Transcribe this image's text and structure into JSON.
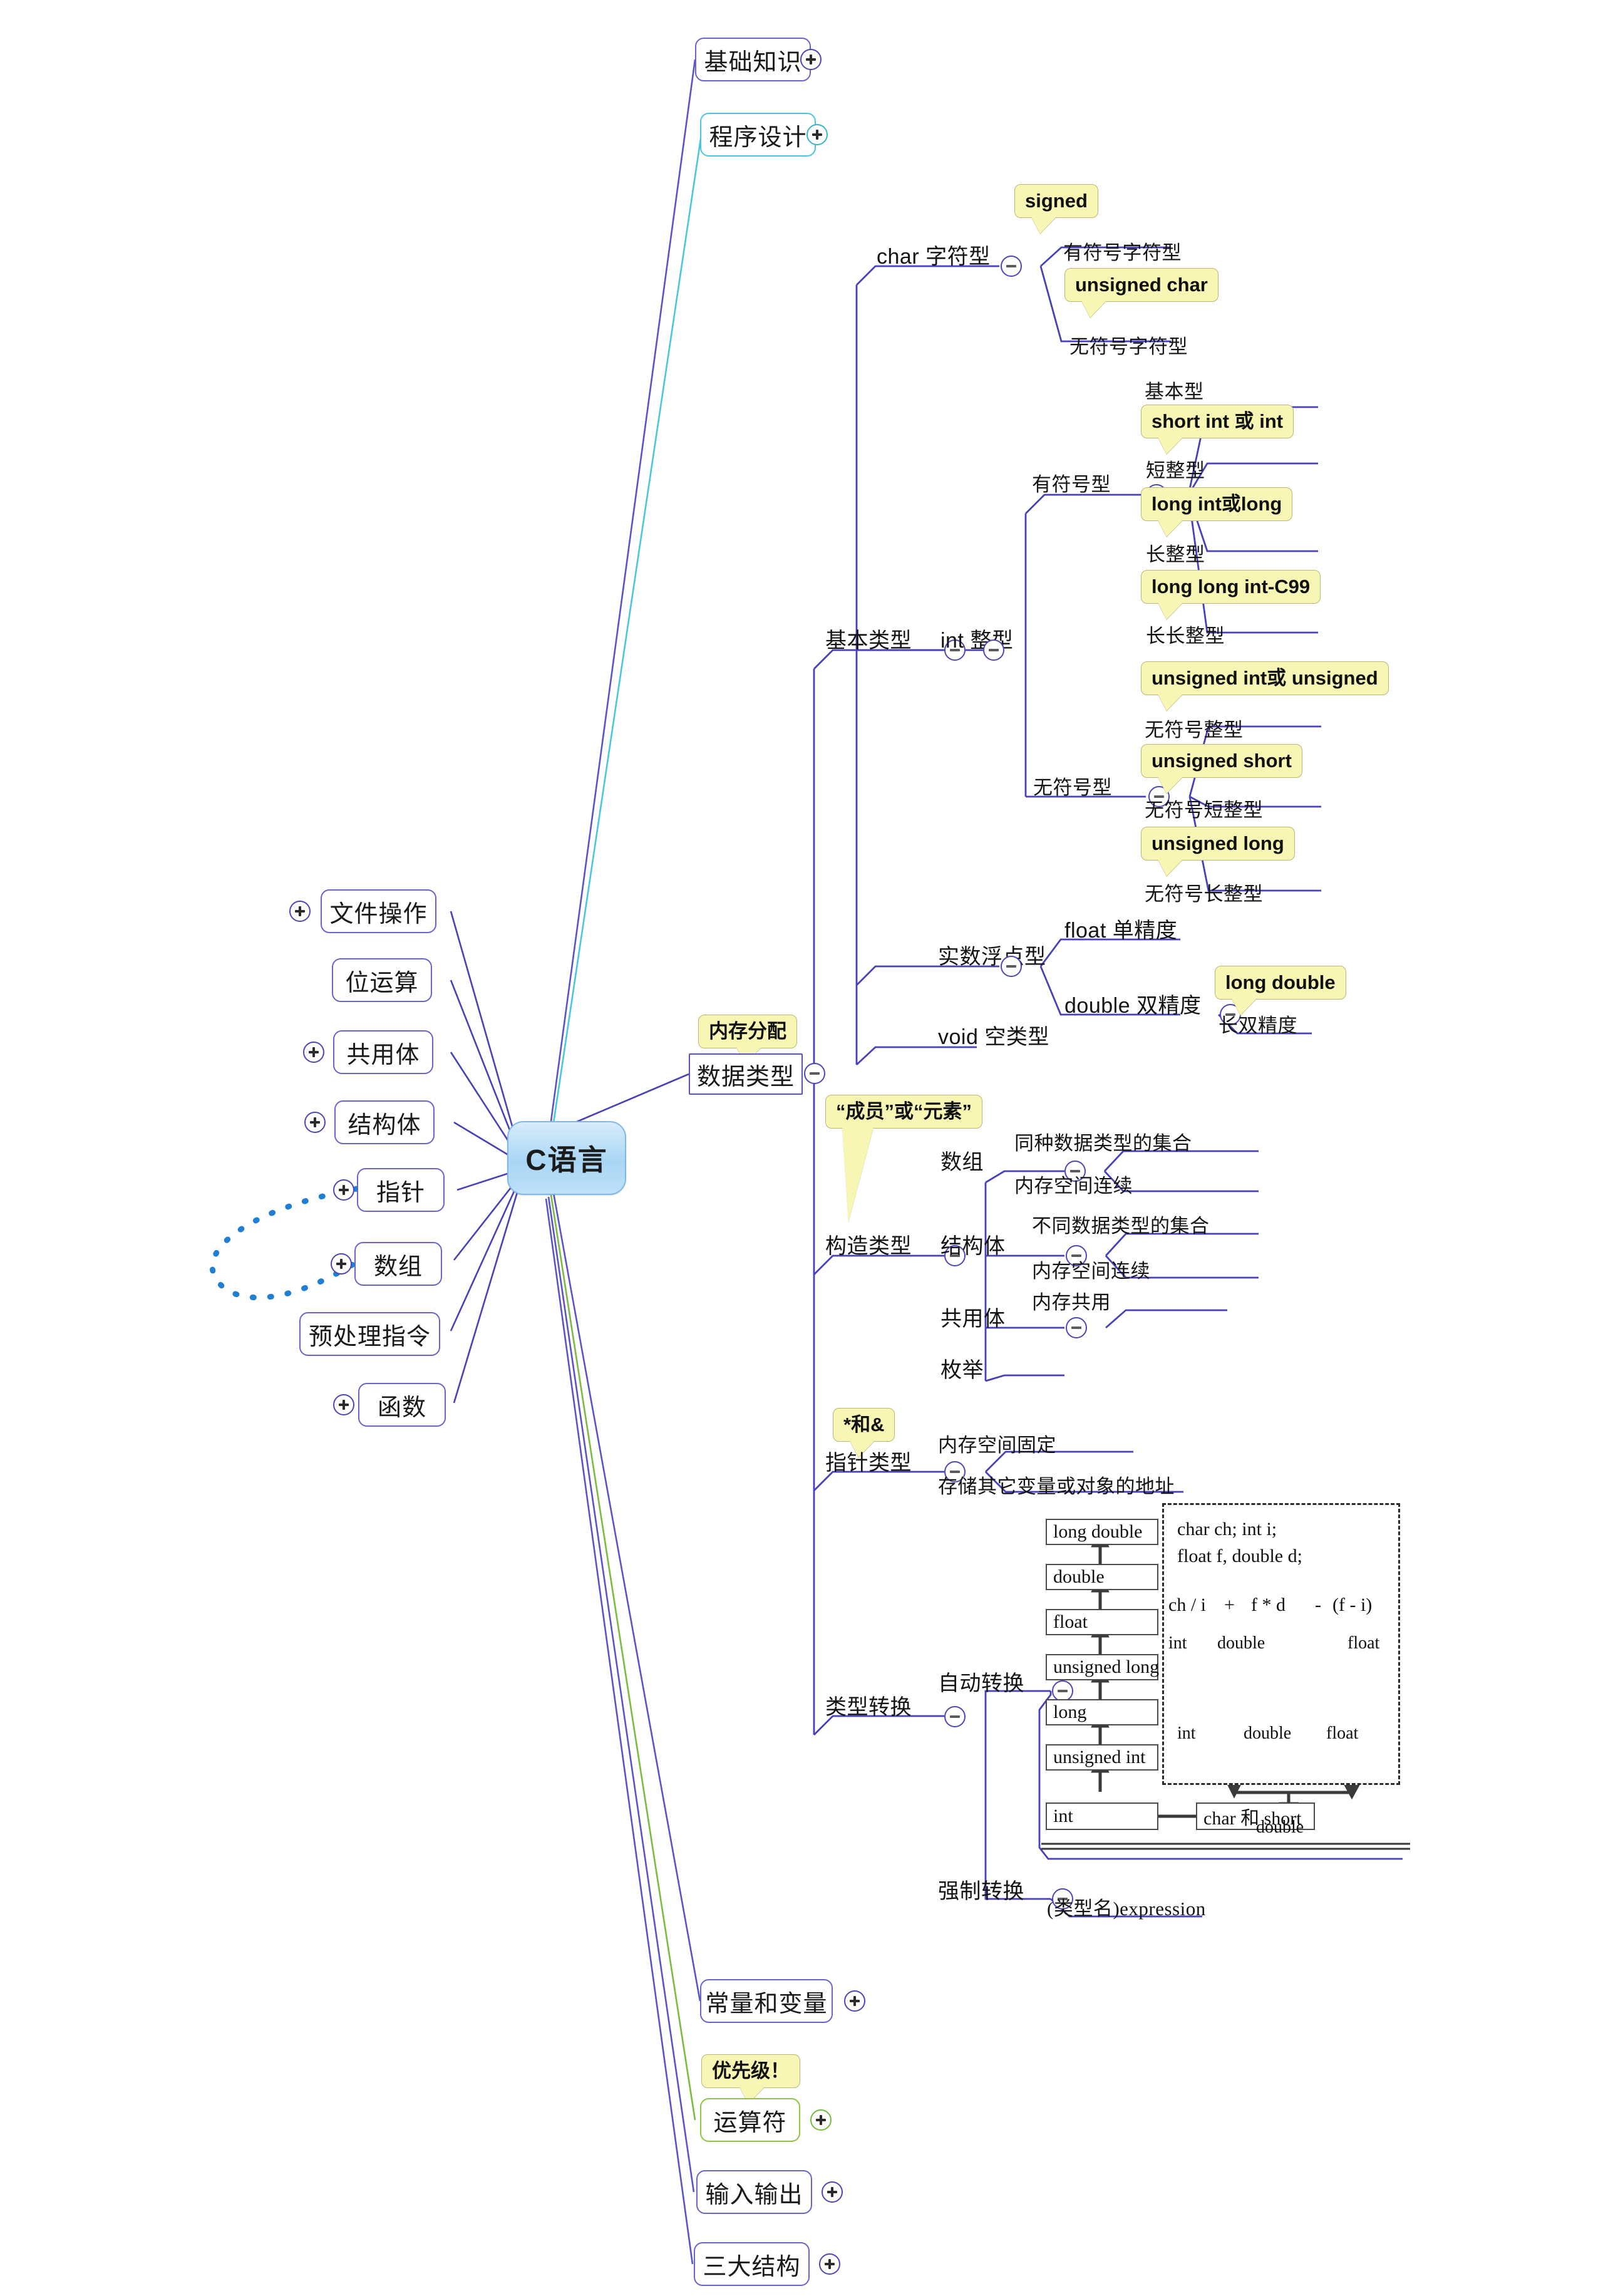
{
  "central": {
    "label": "C语言"
  },
  "left_branches": [
    {
      "label": "文件操作",
      "toggle": "+"
    },
    {
      "label": "位运算",
      "toggle": ""
    },
    {
      "label": "共用体",
      "toggle": "+"
    },
    {
      "label": "结构体",
      "toggle": "+"
    },
    {
      "label": "指针",
      "toggle": "+"
    },
    {
      "label": "数组",
      "toggle": "+"
    },
    {
      "label": "预处理指令",
      "toggle": ""
    },
    {
      "label": "函数",
      "toggle": "+"
    }
  ],
  "top_branches": [
    {
      "label": "基础知识",
      "toggle": "+",
      "color": "#6a63c8"
    },
    {
      "label": "程序设计",
      "toggle": "+",
      "color": "#49c6dd"
    }
  ],
  "bottom_branches": [
    {
      "label": "常量和变量",
      "toggle": "+",
      "color": "#6a63c8",
      "callout": ""
    },
    {
      "label": "运算符",
      "toggle": "+",
      "color": "#8cc63f",
      "callout": "优先级！"
    },
    {
      "label": "输入输出",
      "toggle": "+",
      "color": "#6a63c8",
      "callout": ""
    },
    {
      "label": "三大结构",
      "toggle": "+",
      "color": "#6a63c8",
      "callout": ""
    }
  ],
  "data_type": {
    "label": "数据类型",
    "callout": "内存分配",
    "toggle": "-",
    "children": [
      {
        "label": "基本类型",
        "toggle": "-",
        "children": [
          {
            "label": "char 字符型",
            "toggle": "-",
            "children": [
              {
                "label": "有符号字符型",
                "callout": "signed"
              },
              {
                "label": "无符号字符型",
                "callout": "unsigned char"
              }
            ]
          },
          {
            "label": "int 整型",
            "toggle": "-",
            "children": [
              {
                "label": "有符号型",
                "toggle": "-",
                "children": [
                  {
                    "label": "基本型",
                    "callout": ""
                  },
                  {
                    "label": "短整型",
                    "callout": "short int 或 int"
                  },
                  {
                    "label": "长整型",
                    "callout": "long int或long"
                  },
                  {
                    "label": "长长整型",
                    "callout": "long long int-C99"
                  }
                ]
              },
              {
                "label": "无符号型",
                "toggle": "-",
                "children": [
                  {
                    "label": "无符号整型",
                    "callout": "unsigned int或 unsigned"
                  },
                  {
                    "label": "无符号短整型",
                    "callout": "unsigned short"
                  },
                  {
                    "label": "无符号长整型",
                    "callout": "unsigned long"
                  }
                ]
              }
            ]
          },
          {
            "label": "实数浮点型",
            "toggle": "-",
            "children": [
              {
                "label": "float 单精度"
              },
              {
                "label": "double 双精度",
                "toggle": "-",
                "children": [
                  {
                    "label": "长双精度",
                    "callout": "long double"
                  }
                ]
              }
            ]
          },
          {
            "label": "void 空类型"
          }
        ]
      },
      {
        "label": "构造类型",
        "toggle": "-",
        "callout": "“成员”或“元素”",
        "children": [
          {
            "label": "数组",
            "toggle": "-",
            "children": [
              {
                "label": "同种数据类型的集合"
              },
              {
                "label": "内存空间连续"
              }
            ]
          },
          {
            "label": "结构体",
            "toggle": "-",
            "children": [
              {
                "label": "不同数据类型的集合"
              },
              {
                "label": "内存空间连续"
              }
            ]
          },
          {
            "label": "共用体",
            "toggle": "-",
            "children": [
              {
                "label": "内存共用"
              }
            ]
          },
          {
            "label": "枚举"
          }
        ]
      },
      {
        "label": "指针类型",
        "toggle": "-",
        "callout": "*和&",
        "children": [
          {
            "label": "内存空间固定"
          },
          {
            "label": "存储其它变量或对象的地址"
          }
        ]
      },
      {
        "label": "类型转换",
        "toggle": "-",
        "children": [
          {
            "label": "自动转换",
            "toggle": "-"
          },
          {
            "label": "强制转换",
            "toggle": "-",
            "children": [
              {
                "label": "(类型名)expression"
              }
            ]
          }
        ]
      }
    ]
  },
  "conversion_figure": {
    "ladder": [
      "long double",
      "double",
      "float",
      "unsigned long",
      "long",
      "unsigned int",
      "int"
    ],
    "side_box": "char 和 short",
    "declarations": [
      "char ch;    int i;",
      "float f,    double d;"
    ],
    "expression_terms": [
      "ch / i",
      "+",
      "f * d",
      "-",
      "(f - i)"
    ],
    "level1": [
      "int",
      "double",
      "float"
    ],
    "level2": [
      "int",
      "double",
      "float"
    ],
    "result": "double"
  }
}
